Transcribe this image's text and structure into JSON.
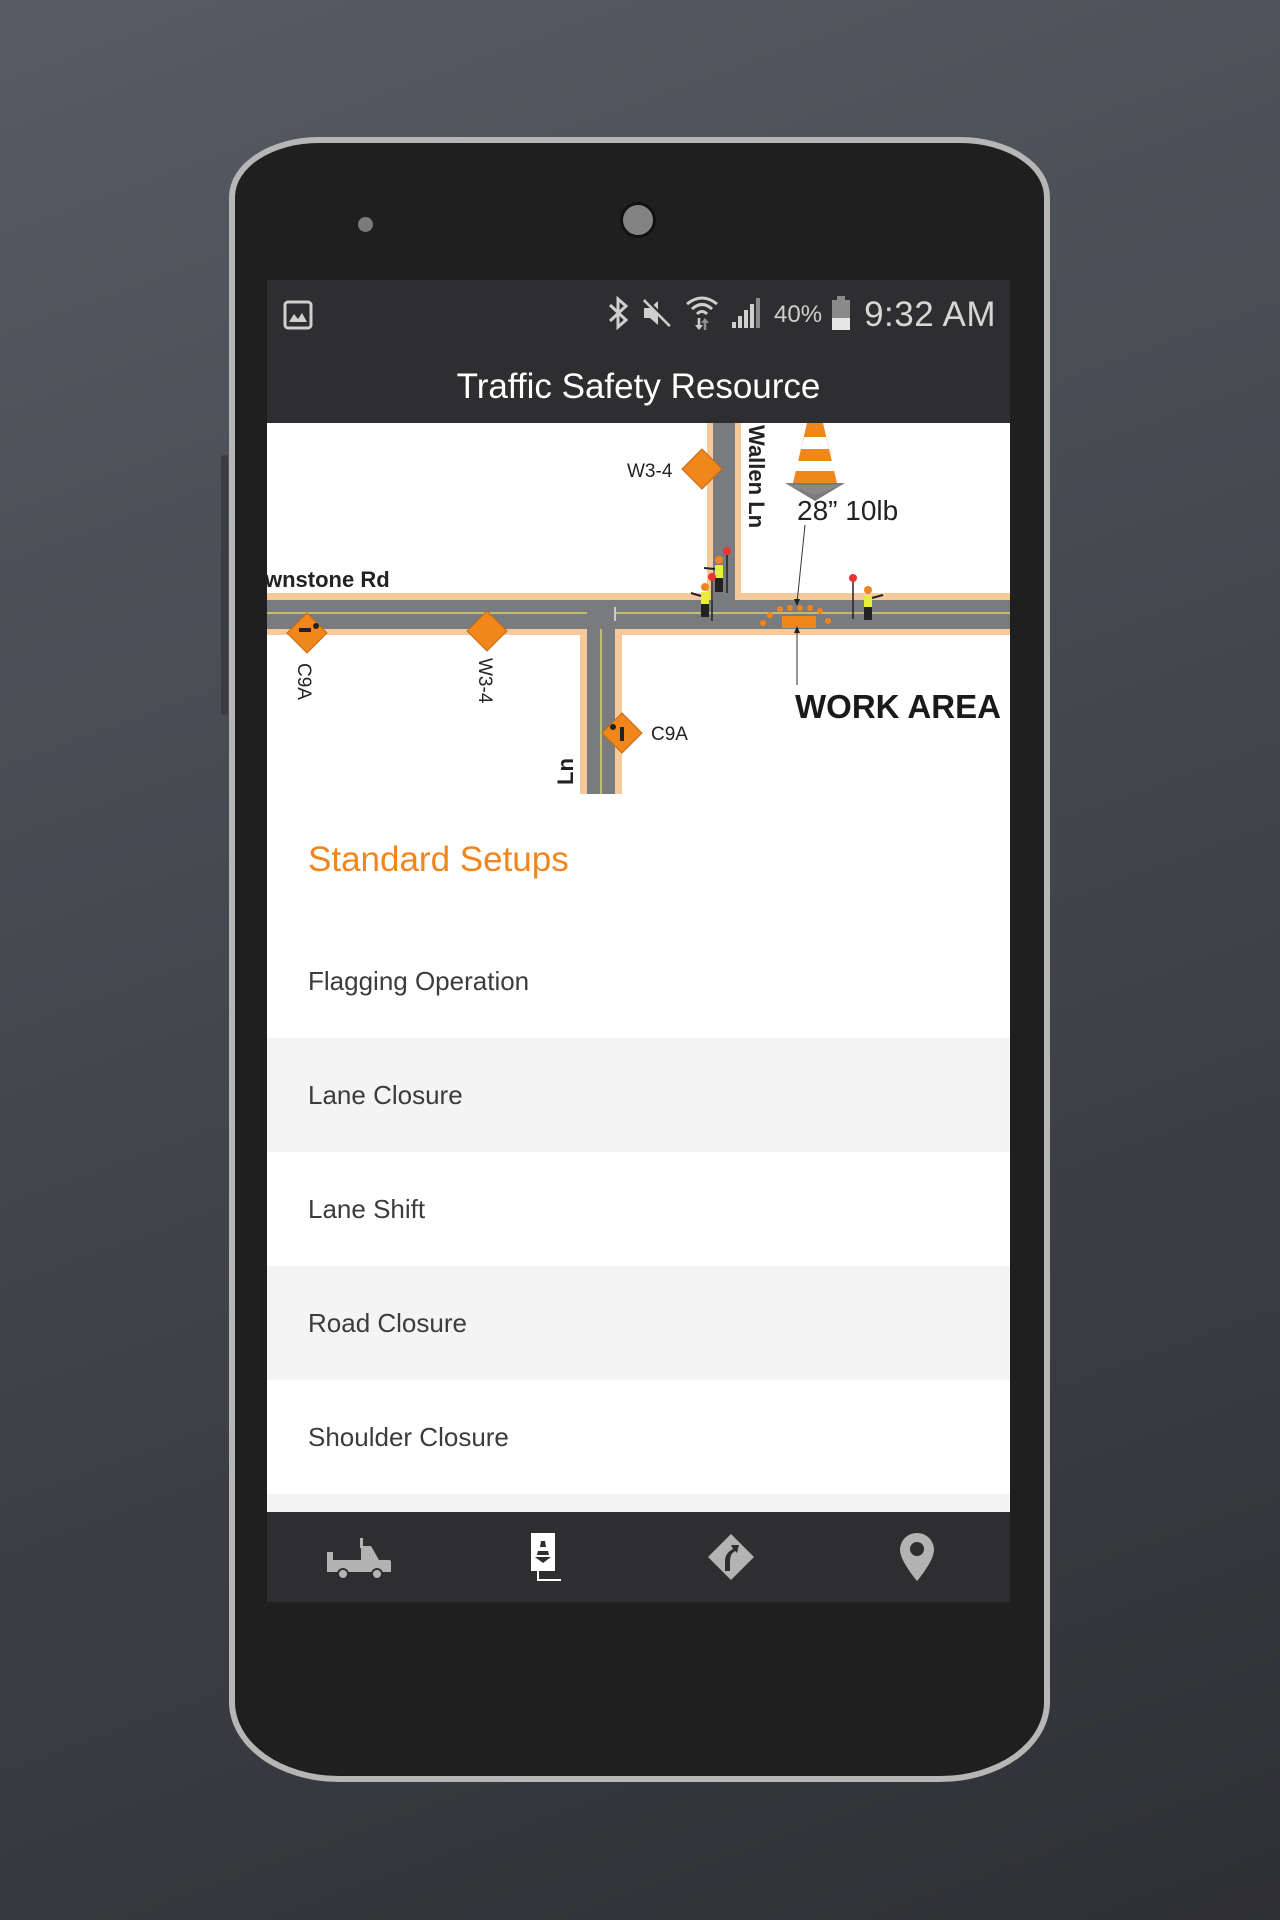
{
  "status_bar": {
    "left_icon": "image-notification-icon",
    "icons": [
      "bluetooth-icon",
      "mute-icon",
      "wifi-icon",
      "signal-icon"
    ],
    "battery_percent": "40%",
    "battery_level": 0.4,
    "time": "9:32 AM"
  },
  "app_bar": {
    "title": "Traffic Safety Resource"
  },
  "map": {
    "road_labels": [
      "wnstone Rd",
      "Wallen Ln",
      "Ln"
    ],
    "sign_labels": [
      "W3-4",
      "C9A",
      "W3-4",
      "C9A"
    ],
    "cone_label": "28” 10lb",
    "work_area_label": "WORK AREA",
    "colors": {
      "road": "#7a7b7e",
      "shoulder": "#f6c99b",
      "sign": "#f0861c",
      "centerline": "#d6d36a"
    }
  },
  "section": {
    "title": "Standard Setups",
    "color": "#f0861c"
  },
  "list": {
    "items": [
      {
        "label": "Flagging Operation"
      },
      {
        "label": "Lane Closure"
      },
      {
        "label": "Lane Shift"
      },
      {
        "label": "Road Closure"
      },
      {
        "label": "Shoulder Closure"
      }
    ]
  },
  "tabs": [
    {
      "name": "truck",
      "icon": "truck-icon",
      "active": false
    },
    {
      "name": "setups",
      "icon": "cone-document-icon",
      "active": true
    },
    {
      "name": "signs",
      "icon": "road-sign-icon",
      "active": false
    },
    {
      "name": "location",
      "icon": "map-pin-icon",
      "active": false
    }
  ]
}
